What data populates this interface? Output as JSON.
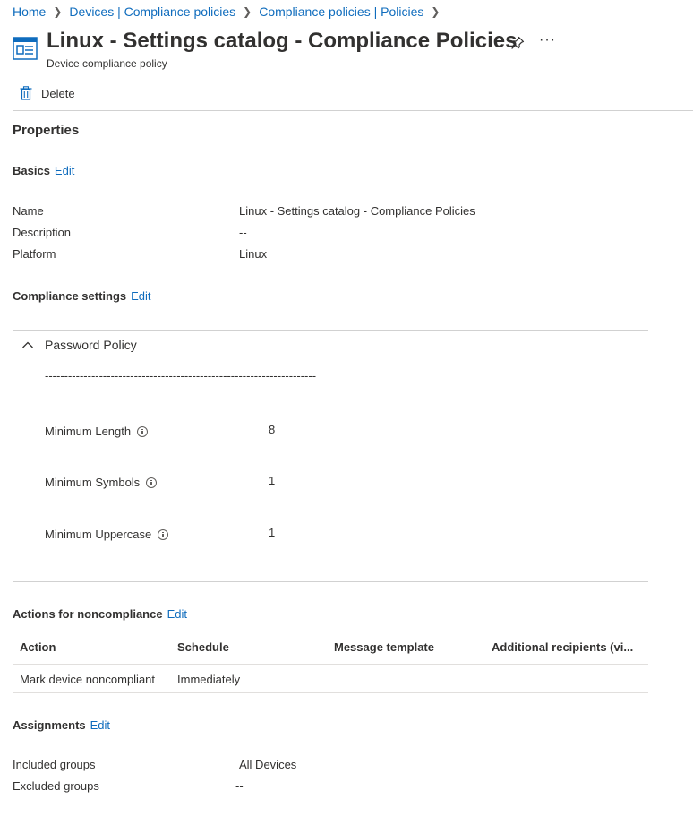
{
  "breadcrumb": [
    "Home",
    "Devices | Compliance policies",
    "Compliance policies | Policies"
  ],
  "header": {
    "title": "Linux - Settings catalog - Compliance Policies",
    "subtitle": "Device compliance policy",
    "more_label": "···"
  },
  "toolbar": {
    "delete_label": "Delete"
  },
  "properties_heading": "Properties",
  "basics": {
    "title": "Basics",
    "edit_label": "Edit",
    "rows": [
      {
        "label": "Name",
        "value": "Linux - Settings catalog - Compliance Policies"
      },
      {
        "label": "Description",
        "value": "--"
      },
      {
        "label": "Platform",
        "value": "Linux"
      }
    ]
  },
  "compliance": {
    "title": "Compliance settings",
    "edit_label": "Edit",
    "group_title": "Password Policy",
    "dashes": "----------------------------------------------------------------------",
    "settings": [
      {
        "label": "Minimum Length",
        "value": "8"
      },
      {
        "label": "Minimum Symbols",
        "value": "1"
      },
      {
        "label": "Minimum Uppercase",
        "value": "1"
      }
    ]
  },
  "actions": {
    "title": "Actions for noncompliance",
    "edit_label": "Edit",
    "columns": [
      "Action",
      "Schedule",
      "Message template",
      "Additional recipients (vi..."
    ],
    "rows": [
      [
        "Mark device noncompliant",
        "Immediately",
        "",
        ""
      ]
    ]
  },
  "assignments": {
    "title": "Assignments",
    "edit_label": "Edit",
    "rows": [
      {
        "label": "Included groups",
        "value": "All Devices"
      },
      {
        "label": "Excluded groups",
        "value": "--"
      }
    ]
  }
}
